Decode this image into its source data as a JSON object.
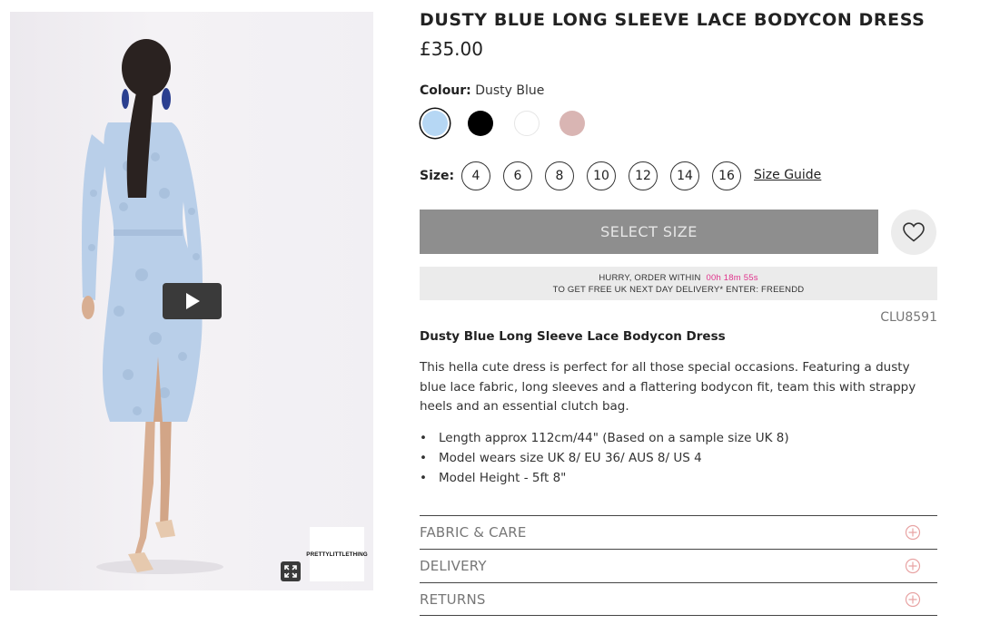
{
  "product": {
    "title": "DUSTY BLUE LONG SLEEVE LACE BODYCON DRESS",
    "price": "£35.00",
    "sku": "CLU8591"
  },
  "media": {
    "brand_logo_text": "PRETTYLITTLETHING",
    "play_icon": "play-icon",
    "expand_icon": "fullscreen-icon"
  },
  "colour": {
    "label": "Colour:",
    "value": "Dusty Blue",
    "swatches": [
      {
        "name": "Dusty Blue",
        "color": "#b6d7f4",
        "selected": true
      },
      {
        "name": "Black",
        "color": "#000000",
        "selected": false
      },
      {
        "name": "White",
        "color": "#ffffff",
        "selected": false
      },
      {
        "name": "Pink",
        "color": "#d9b5b3",
        "selected": false
      }
    ]
  },
  "size": {
    "label": "Size:",
    "options": [
      "4",
      "6",
      "8",
      "10",
      "12",
      "14",
      "16"
    ],
    "guide_label": "Size Guide"
  },
  "actions": {
    "select_size_label": "SELECT SIZE",
    "wishlist_icon": "heart-icon"
  },
  "promo": {
    "line1": "HURRY, ORDER WITHIN",
    "timer": "00h 18m 55s",
    "line2": "TO GET FREE UK NEXT DAY DELIVERY* ENTER: FREENDD",
    "timer_color": "#e0338c"
  },
  "description": {
    "title": "Dusty Blue Long Sleeve Lace Bodycon Dress",
    "body": "This hella cute dress is perfect for all those special occasions. Featuring a dusty blue lace fabric, long sleeves and a flattering bodycon fit, team this with strappy heels and an essential clutch bag.",
    "bullets": [
      "Length approx 112cm/44\" (Based on a sample size UK 8)",
      "Model wears size UK 8/ EU 36/ AUS 8/ US 4",
      "Model Height - 5ft 8\""
    ]
  },
  "accordion": [
    {
      "label": "FABRIC & CARE",
      "icon": "plus-circle-icon"
    },
    {
      "label": "DELIVERY",
      "icon": "plus-circle-icon"
    },
    {
      "label": "RETURNS",
      "icon": "plus-circle-icon"
    }
  ],
  "colors": {
    "accent_pink": "#e8a3a3",
    "button_grey": "#8e8e8e"
  }
}
